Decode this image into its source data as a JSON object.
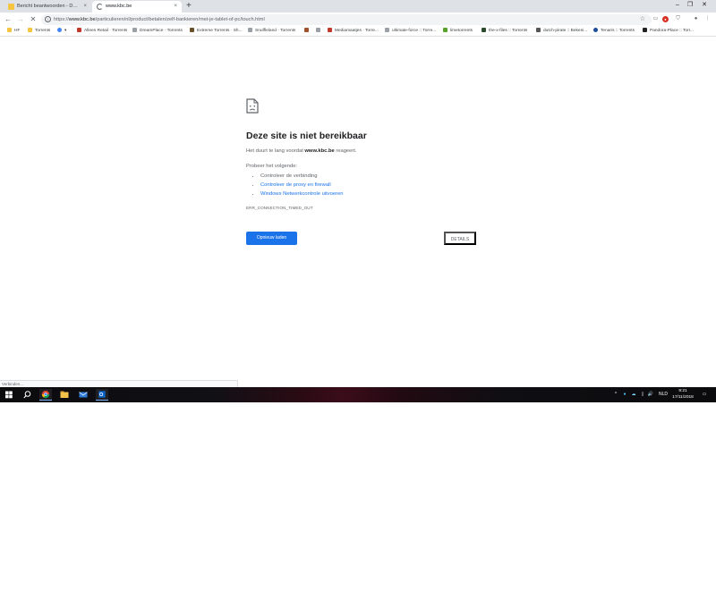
{
  "tabs": [
    {
      "title": "Bericht beantwoorden - De Nete",
      "close_icon": "×"
    },
    {
      "title": "www.kbc.be",
      "close_icon": "×"
    }
  ],
  "new_tab_icon": "+",
  "window_controls": {
    "minimize": "–",
    "maximize": "❐",
    "close": "✕"
  },
  "toolbar": {
    "back_icon": "←",
    "forward_icon": "→",
    "stop_icon": "✕",
    "url_scheme": "https://",
    "url_host": "www.kbc.be",
    "url_path": "/particulieren/nl/product/betalen/zelf-bankieren/met-je-tablet-of-pc/touch.html",
    "star_icon": "☆",
    "menu_icon": "⋮"
  },
  "bookmarks": [
    {
      "label": "HF",
      "color": "#f5c542"
    },
    {
      "label": "Torrents",
      "color": "#f5c542"
    },
    {
      "label": "",
      "color": "#4285f4"
    },
    {
      "label": "Alleen Retail · Torrents",
      "color": "#c0392b"
    },
    {
      "label": "DreamPlace · Torrents",
      "color": "#9aa0a6"
    },
    {
      "label": "Extreme Torrents · Sh...",
      "color": "#6b4f2a"
    },
    {
      "label": "Snuffleland · Torrents",
      "color": "#9aa0a6"
    },
    {
      "label": "",
      "color": "#a0522d"
    },
    {
      "label": "",
      "color": "#9aa0a6"
    },
    {
      "label": "Mediamaatjes · Torre...",
      "color": "#c0392b"
    },
    {
      "label": "ultimate-force :: Torre...",
      "color": "#9aa0a6"
    },
    {
      "label": "limetorrents",
      "color": "#5aa02c"
    },
    {
      "label": "the-x-files :: Torrents",
      "color": "#2e4a2e"
    },
    {
      "label": "dutch-pirate :: Bekeni...",
      "color": "#555555"
    },
    {
      "label": "Tenaris :: Torrents",
      "color": "#1f4e9e"
    },
    {
      "label": "Pandora-Place :: Torr...",
      "color": "#222222"
    }
  ],
  "error": {
    "title": "Deze site is niet bereikbaar",
    "message_prefix": "Het duurt te lang voordat ",
    "message_host": "www.kbc.be",
    "message_suffix": " reageert.",
    "try_label": "Probeer het volgende:",
    "suggestions": [
      {
        "text": "Controleer de verbinding",
        "link": false
      },
      {
        "text": "Controleer de proxy en firewall",
        "link": true
      },
      {
        "text": "Windows Netwerkcontrole uitvoeren",
        "link": true
      }
    ],
    "code": "ERR_CONNECTION_TIMED_OUT",
    "reload_label": "Opnieuw laden",
    "details_label": "DETAILS"
  },
  "status_bar": "Verbinden...",
  "taskbar": {
    "language": "NLD",
    "time": "9:21",
    "date": "17/11/2018",
    "tray_chevron": "^",
    "volume_icon": "🔊",
    "notification_icon": "▭"
  }
}
